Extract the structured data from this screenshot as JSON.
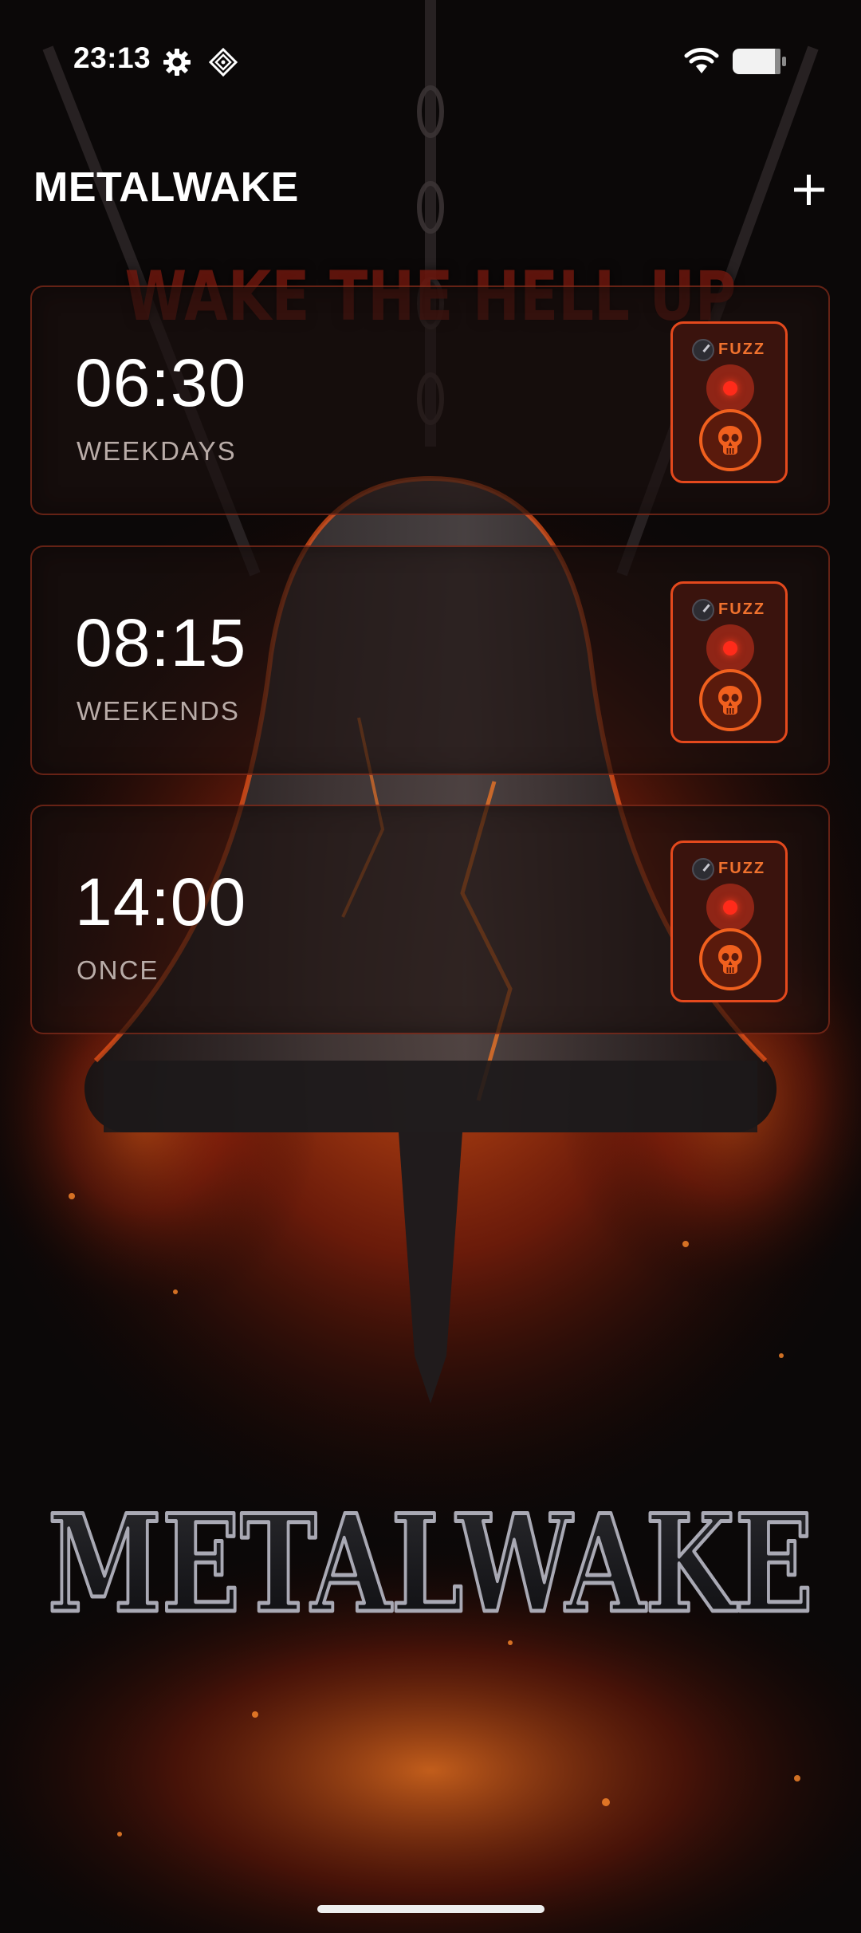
{
  "status_bar": {
    "time": "23:13",
    "icons": [
      "gear-icon",
      "diamond-logo-icon",
      "wifi-icon",
      "battery-icon"
    ]
  },
  "header": {
    "title": "METALWAKE",
    "add_icon": "plus-icon"
  },
  "background": {
    "tagline": "WAKE THE HELL UP",
    "logo_text": "METALWAKE"
  },
  "alarms": [
    {
      "time": "06:30",
      "repeat": "WEEKDAYS",
      "pedal_label": "FUZZ",
      "enabled": true
    },
    {
      "time": "08:15",
      "repeat": "WEEKENDS",
      "pedal_label": "FUZZ",
      "enabled": true
    },
    {
      "time": "14:00",
      "repeat": "ONCE",
      "pedal_label": "FUZZ",
      "enabled": true
    }
  ],
  "colors": {
    "accent": "#e4491d",
    "led": "#ff2b1a",
    "card_border": "#aa341e",
    "repeat_text": "#b9aca8"
  }
}
